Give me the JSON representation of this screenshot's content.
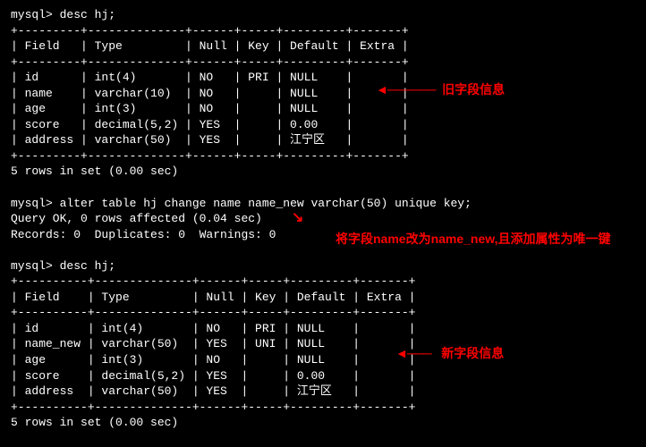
{
  "prompt": "mysql>",
  "cmd_desc1": "desc hj;",
  "table1": {
    "border_top": "+---------+--------------+------+-----+---------+-------+",
    "header": "| Field   | Type         | Null | Key | Default | Extra |",
    "border_mid": "+---------+--------------+------+-----+---------+-------+",
    "rows": [
      "| id      | int(4)       | NO   | PRI | NULL    |       |",
      "| name    | varchar(10)  | NO   |     | NULL    |       |",
      "| age     | int(3)       | NO   |     | NULL    |       |",
      "| score   | decimal(5,2) | YES  |     | 0.00    |       |",
      "| address | varchar(50)  | YES  |     | 江宁区   |       |"
    ],
    "border_bot": "+---------+--------------+------+-----+---------+-------+"
  },
  "result1": "5 rows in set (0.00 sec)",
  "cmd_alter": "alter table hj change name name_new varchar(50) unique key;",
  "alter_out1": "Query OK, 0 rows affected (0.04 sec)",
  "alter_out2": "Records: 0  Duplicates: 0  Warnings: 0",
  "cmd_desc2": "desc hj;",
  "table2": {
    "border_top": "+----------+--------------+------+-----+---------+-------+",
    "header": "| Field    | Type         | Null | Key | Default | Extra |",
    "border_mid": "+----------+--------------+------+-----+---------+-------+",
    "rows": [
      "| id       | int(4)       | NO   | PRI | NULL    |       |",
      "| name_new | varchar(50)  | YES  | UNI | NULL    |       |",
      "| age      | int(3)       | NO   |     | NULL    |       |",
      "| score    | decimal(5,2) | YES  |     | 0.00    |       |",
      "| address  | varchar(50)  | YES  |     | 江宁区   |       |"
    ],
    "border_bot": "+----------+--------------+------+-----+---------+-------+"
  },
  "result2": "5 rows in set (0.00 sec)",
  "annotations": {
    "old": "旧字段信息",
    "change": "将字段name改为name_new,且添加属性为唯一键",
    "new": "新字段信息"
  },
  "arrows": {
    "long_left": "◄──────",
    "short_left": "◄───",
    "diag": "↘"
  }
}
